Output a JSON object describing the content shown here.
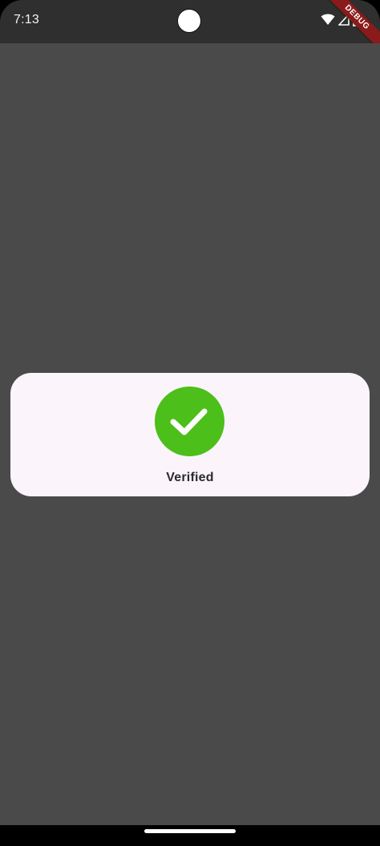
{
  "status_bar": {
    "time": "7:13",
    "icons": [
      "wifi-icon",
      "signal-icon",
      "battery-icon"
    ],
    "debug_banner": "DEBUG"
  },
  "dialog": {
    "icon": "check-icon",
    "label": "Verified"
  },
  "colors": {
    "status_bar_bg": "#2f2f2f",
    "body_bg": "#4a4a4a",
    "card_bg": "#fbf4fb",
    "success_green": "#4cbf1a",
    "debug_red": "#8b1a1a"
  }
}
